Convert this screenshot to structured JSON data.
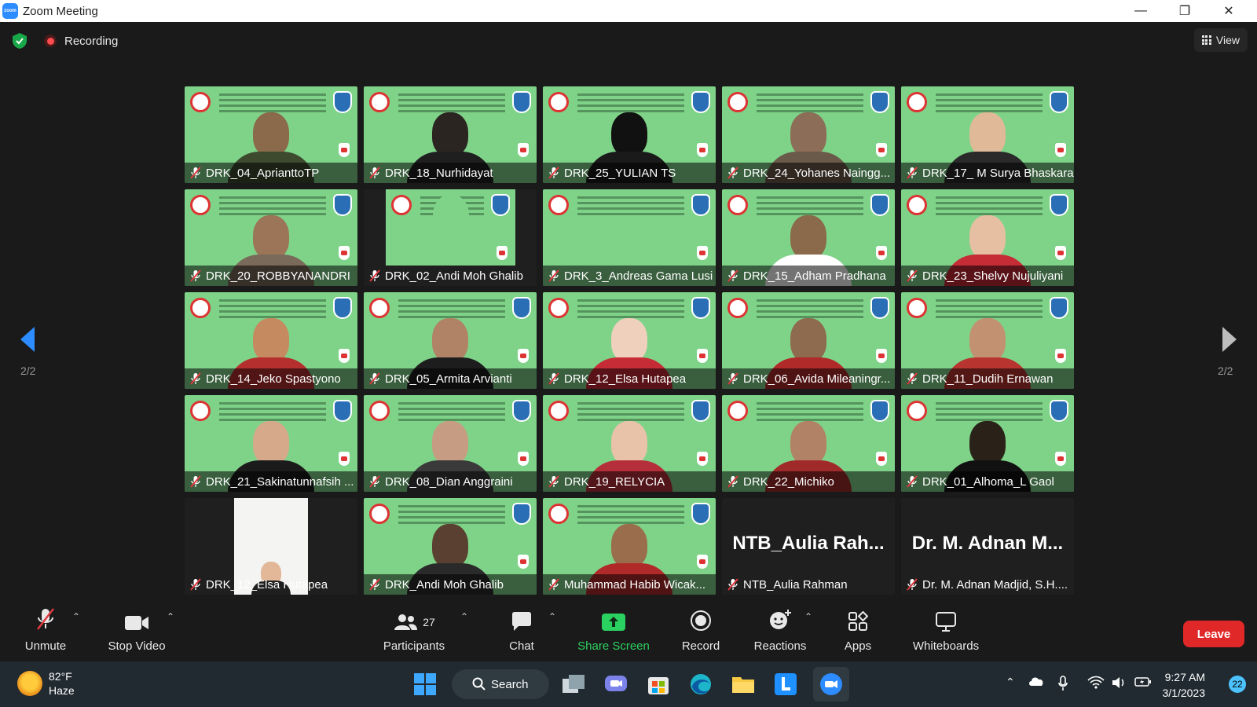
{
  "window": {
    "title": "Zoom Meeting",
    "logo_text": "zoom",
    "controls": {
      "minimize": "—",
      "restore": "❐",
      "close": "✕"
    }
  },
  "topbar": {
    "recording_label": "Recording",
    "view_label": "View"
  },
  "pager": {
    "left_label": "2/2",
    "right_label": "2/2"
  },
  "participants": [
    {
      "name": "DRK_04_AprianttoTP",
      "video": "green",
      "skin": "#8a6a4a",
      "shirt": "#3d4a2e"
    },
    {
      "name": "DRK_18_Nurhidayat",
      "video": "green",
      "skin": "#2a2520",
      "shirt": "#1f1f1f"
    },
    {
      "name": "DRK_25_YULIAN TS",
      "video": "green",
      "skin": "#111111",
      "shirt": "#1a1a1a"
    },
    {
      "name": "DRK_24_Yohanes Naingg...",
      "video": "green",
      "skin": "#8c6d58",
      "shirt": "#6a5a4a"
    },
    {
      "name": "DRK_17_ M Surya Bhaskara",
      "video": "green",
      "skin": "#e0b999",
      "shirt": "#2a2a2a"
    },
    {
      "name": "DRK_20_ROBBYANANDRI",
      "video": "green",
      "skin": "#9c7458",
      "shirt": "#7a6a5a"
    },
    {
      "name": "DRK_02_Andi Moh Ghalib",
      "video": "partial",
      "skin": "#7fd389",
      "shirt": "#7fd389"
    },
    {
      "name": "DRK_3_Andreas Gama Lusi",
      "video": "green",
      "skin": "#7fd389",
      "shirt": "#7fd389"
    },
    {
      "name": "DRK_15_Adham Pradhana",
      "video": "green",
      "skin": "#8a6a4a",
      "shirt": "#ffffff"
    },
    {
      "name": "DRK_23_Shelvy Nujuliyani",
      "video": "green",
      "skin": "#e6bfa2",
      "shirt": "#c62c36"
    },
    {
      "name": "DRK_14_Jeko Spastyono",
      "video": "green",
      "skin": "#c58a5f",
      "shirt": "#b52f2f"
    },
    {
      "name": "DRK_05_Armita Arvianti",
      "video": "green",
      "skin": "#b08366",
      "shirt": "#1d1d1d"
    },
    {
      "name": "DRK_12_Elsa Hutapea",
      "video": "green",
      "skin": "#efd0bd",
      "shirt": "#c62c36"
    },
    {
      "name": "DRK_06_Avida Mileaningr...",
      "video": "green",
      "skin": "#8e6a4e",
      "shirt": "#b12a2a"
    },
    {
      "name": "DRK_11_Dudih Ernawan",
      "video": "green",
      "skin": "#c29172",
      "shirt": "#b8352f"
    },
    {
      "name": "DRK_21_Sakinatunnafsih ...",
      "video": "green",
      "skin": "#d6a98a",
      "shirt": "#1b1b1b"
    },
    {
      "name": "DRK_08_Dian Anggraini",
      "video": "green",
      "skin": "#c69c82",
      "shirt": "#3a3a3a"
    },
    {
      "name": "DRK_19_RELYCIA",
      "video": "green",
      "skin": "#e8c3a9",
      "shirt": "#b52f3a"
    },
    {
      "name": "DRK_22_Michiko",
      "video": "green",
      "skin": "#b28266",
      "shirt": "#a02a2a"
    },
    {
      "name": "DRK_01_Alhoma_L Gaol",
      "video": "green",
      "skin": "#2a2218",
      "shirt": "#111111"
    },
    {
      "name": "DRK_12_Elsa Hutapea",
      "video": "phone",
      "skin": "#e3b899",
      "shirt": "#e8e8e8"
    },
    {
      "name": "DRK_Andi Moh Ghalib",
      "video": "green",
      "skin": "#5a4030",
      "shirt": "#2a2a2a"
    },
    {
      "name": "Muhammad Habib Wicak...",
      "video": "green",
      "skin": "#9a6d4c",
      "shirt": "#b12a2a"
    },
    {
      "name": "NTB_Aulia Rahman",
      "video": "off",
      "display": "NTB_Aulia Rah..."
    },
    {
      "name": "Dr. M. Adnan Madjid, S.H....",
      "video": "off",
      "display": "Dr. M. Adnan M..."
    }
  ],
  "toolbar": {
    "unmute": "Unmute",
    "stop_video": "Stop Video",
    "participants": "Participants",
    "participants_count": "27",
    "chat": "Chat",
    "share_screen": "Share Screen",
    "record": "Record",
    "reactions": "Reactions",
    "apps": "Apps",
    "whiteboards": "Whiteboards",
    "leave": "Leave"
  },
  "taskbar": {
    "temperature": "82°F",
    "condition": "Haze",
    "search_label": "Search",
    "time": "9:27 AM",
    "date": "3/1/2023",
    "notifications": "22"
  },
  "colors": {
    "accent_green": "#2bd160",
    "leave_red": "#e02828",
    "tile_green": "#7fd389",
    "muted_red": "#e0383f"
  }
}
